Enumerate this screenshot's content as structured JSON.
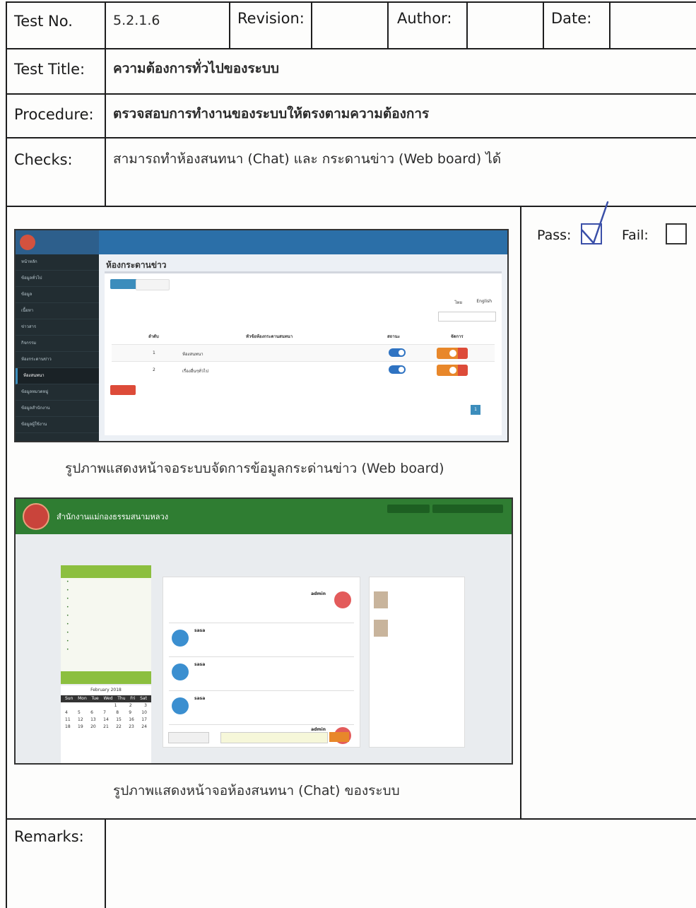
{
  "header": {
    "test_no_label": "Test No.",
    "test_no_value": "5.2.1.6",
    "revision_label": "Revision:",
    "author_label": "Author:",
    "date_label": "Date:"
  },
  "rows": {
    "title_label": "Test Title:",
    "title_value": "ความต้องการทั่วไปของระบบ",
    "procedure_label": "Procedure:",
    "procedure_value": "ตรวจสอบการทำงานของระบบให้ตรงตามความต้องการ",
    "checks_label": "Checks:",
    "checks_value": "สามารถทำห้องสนทนา (Chat) และ กระดานข่าว (Web board) ได้",
    "remarks_label": "Remarks:"
  },
  "result": {
    "pass_label": "Pass:",
    "fail_label": "Fail:",
    "pass_checked": true,
    "fail_checked": false
  },
  "captions": {
    "webboard": "รูปภาพแสดงหน้าจอระบบจัดการข้อมูลกระด่านข่าว (Web board)",
    "chat": "รูปภาพแสดงหน้าจอห้องสนทนา (Chat) ของระบบ"
  },
  "screenshot1": {
    "page_title": "ห้องกระดานข่าว",
    "sidebar": [
      "หน้าหลัก",
      "ข้อมูลทั่วไป",
      "ข้อมูล",
      "เนื้อหา",
      "ข่าวสาร",
      "กิจกรรม",
      "ห้องกระดานข่าว",
      "ห้องสนทนา",
      "ข้อมูลหมวดหมู่",
      "ข้อมูลสำนักงาน",
      "ข้อมูลผู้ใช้งาน"
    ],
    "lang_th": "ไทย",
    "lang_en": "English",
    "table_headers": [
      "ลำดับ",
      "หัวข้อห้องกระดานสนทนา",
      "สถานะ",
      "จัดการ"
    ],
    "table_rows": [
      {
        "no": "1",
        "topic": "ห้องสนทนา"
      },
      {
        "no": "2",
        "topic": "เรื่องอื่นๆทั่วไป"
      }
    ],
    "page_btn": "1"
  },
  "screenshot2": {
    "site_name": "สำนักงานแม่กองธรรมสนามหลวง",
    "calendar_month": "February 2018",
    "calendar_days": [
      "Sun",
      "Mon",
      "Tue",
      "Wed",
      "Thu",
      "Fri",
      "Sat"
    ],
    "calendar_weeks": [
      [
        "",
        "",
        "",
        "",
        "1",
        "2",
        "3"
      ],
      [
        "4",
        "5",
        "6",
        "7",
        "8",
        "9",
        "10"
      ],
      [
        "11",
        "12",
        "13",
        "14",
        "15",
        "16",
        "17"
      ],
      [
        "18",
        "19",
        "20",
        "21",
        "22",
        "23",
        "24"
      ]
    ],
    "chat_user_admin": "admin",
    "chat_user_sasa": "sasa"
  }
}
